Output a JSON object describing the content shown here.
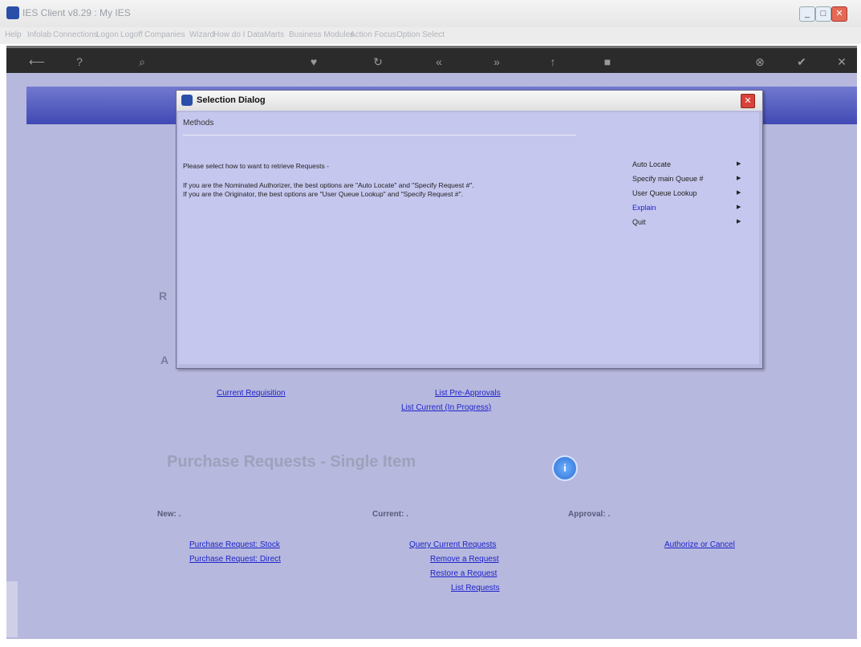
{
  "window": {
    "title": "IES Client v8.29 : My IES",
    "buttons": {
      "minimize": "_",
      "maximize": "□",
      "close": "✕"
    }
  },
  "menubar": [
    "Help",
    "Infolab",
    "Connections",
    "Logon",
    "Logoff",
    "Companies",
    "Wizard",
    "How do I",
    "DataMarts",
    "Business Modules",
    "Action Focus",
    "Option Select"
  ],
  "toolbar": {
    "icons": [
      "back-icon",
      "help-icon",
      "search-icon",
      "heart-icon",
      "refresh-icon",
      "rewind-icon",
      "forward-icon",
      "up-icon",
      "stop-icon",
      "cancel-icon",
      "accept-icon",
      "close-icon"
    ]
  },
  "background": {
    "section_title": "Purchase Requests - Single Item",
    "left_fragments": [
      "R",
      "A"
    ],
    "links_upper": {
      "current_requisition": "Current Requisition",
      "list_pre_approvals": "List Pre-Approvals",
      "list_current": "List Current (In Progress)"
    },
    "headings": {
      "new": "New: .",
      "current": "Current: .",
      "approval": "Approval: ."
    },
    "links_new": [
      "Purchase Request: Stock",
      "Purchase Request: Direct"
    ],
    "links_current": [
      "Query Current Requests",
      "Remove a Request",
      "Restore a Request",
      "List Requests"
    ],
    "links_approval": [
      "Authorize or Cancel"
    ]
  },
  "dialog": {
    "title": "Selection Dialog",
    "heading": "Methods",
    "message_line1": "Please select how to want to retrieve Requests -",
    "message_line2": "If you are the Nominated Authorizer, the best options are \"Auto Locate\" and \"Specify Request #\".",
    "message_line3": "If you are the Originator, the best options are \"User Queue Lookup\" and \"Specify Request #\".",
    "options": [
      "Auto Locate",
      "Specify main Queue #",
      "User Queue Lookup",
      "Explain",
      "Quit"
    ],
    "highlighted_option": "Explain"
  }
}
